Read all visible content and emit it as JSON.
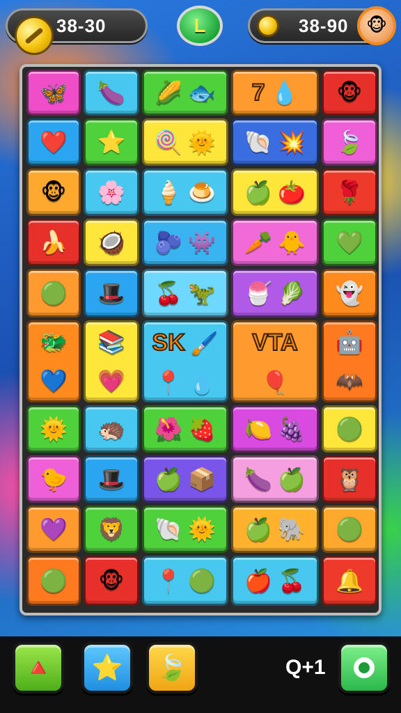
{
  "hud": {
    "left_score": "38-30",
    "right_score": "38-90",
    "level": "L"
  },
  "icons": {
    "left_coin": "wrench-coin-icon",
    "right_coin": "gold-coin-icon",
    "avatar": "monkey-avatar-icon"
  },
  "tiles": [
    {
      "color": "#f04ec8",
      "glyphs": [
        "🦋"
      ]
    },
    {
      "color": "#46c8f0",
      "glyphs": [
        "🍆"
      ]
    },
    {
      "color": "#4fd13c",
      "glyphs": [
        "🌽",
        "🐟"
      ]
    },
    {
      "color": "#ff9a2e",
      "text": "7",
      "glyphs": [
        "💧"
      ]
    },
    {
      "color": "#e8302a",
      "glyphs": [
        "🐵"
      ]
    },
    {
      "color": "#2aa6f0",
      "glyphs": [
        "❤️"
      ]
    },
    {
      "color": "#4fd13c",
      "glyphs": [
        "⭐"
      ]
    },
    {
      "color": "#ffe63a",
      "glyphs": [
        "🍭",
        "🌞"
      ]
    },
    {
      "color": "#3a6ee0",
      "glyphs": [
        "🐚",
        "💥"
      ]
    },
    {
      "color": "#ef5fd8",
      "glyphs": [
        "🍃"
      ]
    },
    {
      "color": "#ffa82e",
      "glyphs": [
        "🐵"
      ]
    },
    {
      "color": "#46c8f0",
      "glyphs": [
        "🌸"
      ]
    },
    {
      "color": "#46c8f0",
      "glyphs": [
        "🍦",
        "🍮"
      ]
    },
    {
      "color": "#ffe63a",
      "glyphs": [
        "🍏",
        "🍅"
      ]
    },
    {
      "color": "#ee3a2a",
      "glyphs": [
        "🌹"
      ]
    },
    {
      "color": "#e8302a",
      "glyphs": [
        "🍌"
      ]
    },
    {
      "color": "#ffe63a",
      "glyphs": [
        "🥥"
      ]
    },
    {
      "color": "#3ab4f0",
      "glyphs": [
        "🫐",
        "👾"
      ]
    },
    {
      "color": "#f06ad8",
      "glyphs": [
        "🥕",
        "🐥"
      ]
    },
    {
      "color": "#4fd13c",
      "glyphs": [
        "💚"
      ]
    },
    {
      "color": "#ff9a2e",
      "glyphs": [
        "🟢"
      ]
    },
    {
      "color": "#2aa6f0",
      "glyphs": [
        "🎩"
      ]
    },
    {
      "color": "#6fd8ff",
      "glyphs": [
        "🍒",
        "🦖"
      ]
    },
    {
      "color": "#b15ae8",
      "glyphs": [
        "🍧",
        "🥬"
      ]
    },
    {
      "color": "#ff8a1e",
      "glyphs": [
        "👻"
      ]
    },
    {
      "color": "#ff8a1e",
      "glyphs": [
        "🐲",
        "💙"
      ]
    },
    {
      "color": "#ffe63a",
      "glyphs": [
        "📚",
        "💗"
      ]
    },
    {
      "color": "#46c8f0",
      "text": "SK",
      "glyphs": [
        "🖌️",
        "📍",
        "💧"
      ]
    },
    {
      "color": "#ff9a2e",
      "text": "VTA",
      "glyphs": [
        "🎈"
      ]
    },
    {
      "color": "#ff7a1e",
      "glyphs": [
        "🤖",
        "🦇"
      ]
    },
    {
      "color": "#4fd13c",
      "glyphs": [
        "🌞"
      ]
    },
    {
      "color": "#46c8f0",
      "glyphs": [
        "🦔"
      ]
    },
    {
      "color": "#4fd13c",
      "glyphs": [
        "🌺",
        "🍓"
      ]
    },
    {
      "color": "#d84ae0",
      "glyphs": [
        "🍋",
        "🍇"
      ]
    },
    {
      "color": "#ffe63a",
      "glyphs": [
        "🟢"
      ]
    },
    {
      "color": "#ef5fd8",
      "glyphs": [
        "🐤"
      ]
    },
    {
      "color": "#2aa6f0",
      "glyphs": [
        "🎩"
      ]
    },
    {
      "color": "#7a56e8",
      "glyphs": [
        "🍏",
        "📦"
      ]
    },
    {
      "color": "#f59ee0",
      "glyphs": [
        "🍆",
        "🍏"
      ]
    },
    {
      "color": "#e8302a",
      "glyphs": [
        "🦉"
      ]
    },
    {
      "color": "#ff9a2e",
      "glyphs": [
        "💜"
      ]
    },
    {
      "color": "#4fd13c",
      "glyphs": [
        "🦁"
      ]
    },
    {
      "color": "#4fd13c",
      "glyphs": [
        "🐚",
        "🌞"
      ]
    },
    {
      "color": "#ffb22e",
      "glyphs": [
        "🍏",
        "🐘"
      ]
    },
    {
      "color": "#ffa82e",
      "glyphs": [
        "🟢"
      ]
    },
    {
      "color": "#ff7a1e",
      "glyphs": [
        "🟢"
      ]
    },
    {
      "color": "#e8302a",
      "glyphs": [
        "🐵"
      ]
    },
    {
      "color": "#46c8f0",
      "glyphs": [
        "📍",
        "🟢"
      ]
    },
    {
      "color": "#46c8f0",
      "glyphs": [
        "🍎",
        "🍒"
      ]
    },
    {
      "color": "#ee3a2a",
      "glyphs": [
        "🔔"
      ]
    }
  ],
  "bottom": {
    "buttons": [
      {
        "name": "arrow-button",
        "icon": "arrow-icon",
        "glyph": "🔺"
      },
      {
        "name": "star-button",
        "icon": "star-icon",
        "glyph": "⭐"
      },
      {
        "name": "leaf-button",
        "icon": "leaf-icon",
        "glyph": "🍃"
      }
    ],
    "moves_label": "Q+1",
    "ok_icon": "ring-icon"
  }
}
